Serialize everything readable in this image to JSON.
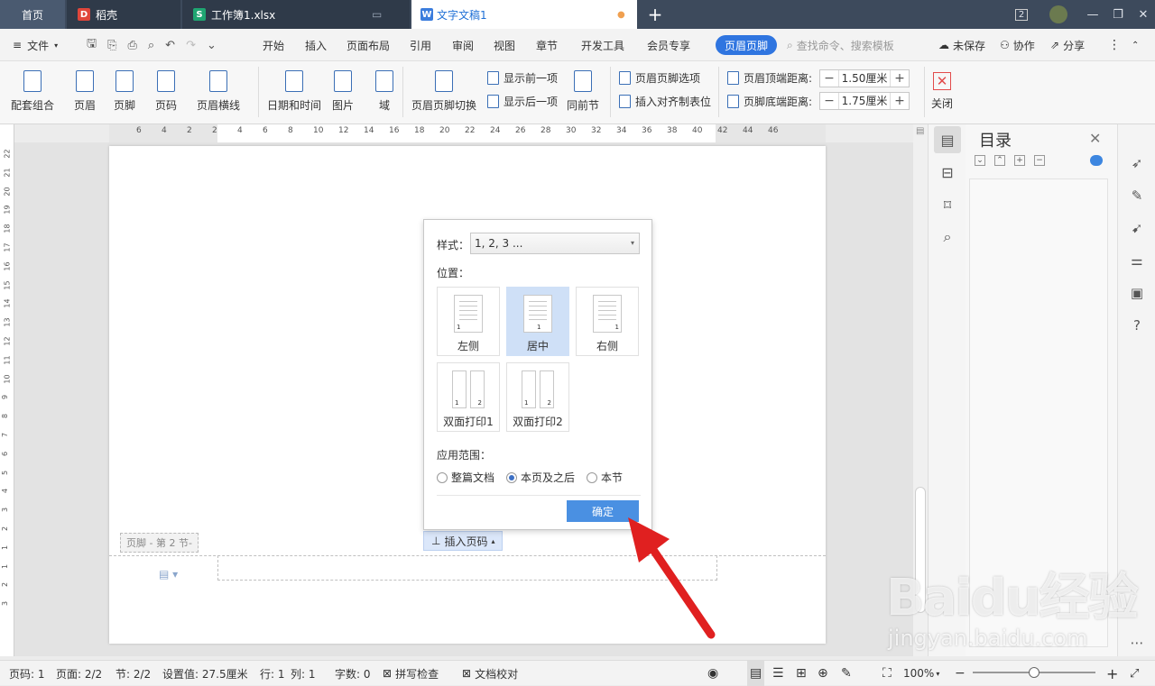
{
  "tabs": {
    "home": "首页",
    "doc1": "稻壳",
    "doc2": "工作簿1.xlsx",
    "active": "文字文稿1",
    "plus": "+"
  },
  "window": {
    "badge": "2"
  },
  "menu": {
    "file": "文件",
    "items": [
      "开始",
      "插入",
      "页面布局",
      "引用",
      "审阅",
      "视图",
      "章节",
      "开发工具",
      "会员专享"
    ],
    "active": "页眉页脚",
    "search_placeholder": "查找命令、搜索模板",
    "unsaved": "未保存",
    "collab": "协作",
    "share": "分享"
  },
  "ribbon": {
    "combo": "配套组合",
    "header": "页眉",
    "footer": "页脚",
    "pagenum": "页码",
    "hline": "页眉横线",
    "datetime": "日期和时间",
    "picture": "图片",
    "field": "域",
    "switch": "页眉页脚切换",
    "prev": "显示前一项",
    "next": "显示后一项",
    "same_prev": "同前节",
    "options": "页眉页脚选项",
    "tab_align": "插入对齐制表位",
    "top_dist_label": "页眉顶端距离:",
    "top_dist": "1.50厘米",
    "bottom_dist_label": "页脚底端距离:",
    "bottom_dist": "1.75厘米",
    "close": "关闭"
  },
  "ruler_h": [
    "6",
    "4",
    "2",
    "2",
    "4",
    "6",
    "8",
    "10",
    "12",
    "14",
    "16",
    "18",
    "20",
    "22",
    "24",
    "26",
    "28",
    "30",
    "32",
    "34",
    "36",
    "38",
    "40",
    "42",
    "44",
    "46"
  ],
  "ruler_v": [
    "22",
    "21",
    "20",
    "19",
    "18",
    "17",
    "16",
    "15",
    "14",
    "13",
    "12",
    "11",
    "10",
    "9",
    "8",
    "7",
    "6",
    "5",
    "4",
    "3",
    "2",
    "1",
    "1",
    "2",
    "3"
  ],
  "doc": {
    "footer_tag": "页脚 - 第 2 节-",
    "insert_pagenum": "插入页码"
  },
  "dialog": {
    "style_label": "样式：",
    "style_value": "1, 2, 3 ...",
    "position_label": "位置：",
    "options": [
      {
        "label": "左侧",
        "num": "1"
      },
      {
        "label": "居中",
        "num": "1"
      },
      {
        "label": "右侧",
        "num": "1"
      },
      {
        "label": "双面打印1",
        "nums": [
          "1",
          "2"
        ]
      },
      {
        "label": "双面打印2",
        "nums": [
          "1",
          "2"
        ]
      }
    ],
    "scope_label": "应用范围：",
    "scope": [
      "整篇文档",
      "本页及之后",
      "本节"
    ],
    "scope_selected": "本页及之后",
    "ok": "确定"
  },
  "toc": {
    "title": "目录"
  },
  "status": {
    "page": "页码: 1",
    "pages": "页面: 2/2",
    "section": "节: 2/2",
    "setting": "设置值: 27.5厘米",
    "row": "行: 1",
    "col": "列: 1",
    "words": "字数: 0",
    "spell": "拼写检查",
    "proof": "文档校对",
    "zoom": "100%"
  },
  "watermark": {
    "logo": "Baidu经验",
    "url": "jingyan.baidu.com"
  },
  "colors": {
    "accent": "#2f75e0",
    "tabbar": "#3d4a5c",
    "arrow": "#e02020"
  }
}
